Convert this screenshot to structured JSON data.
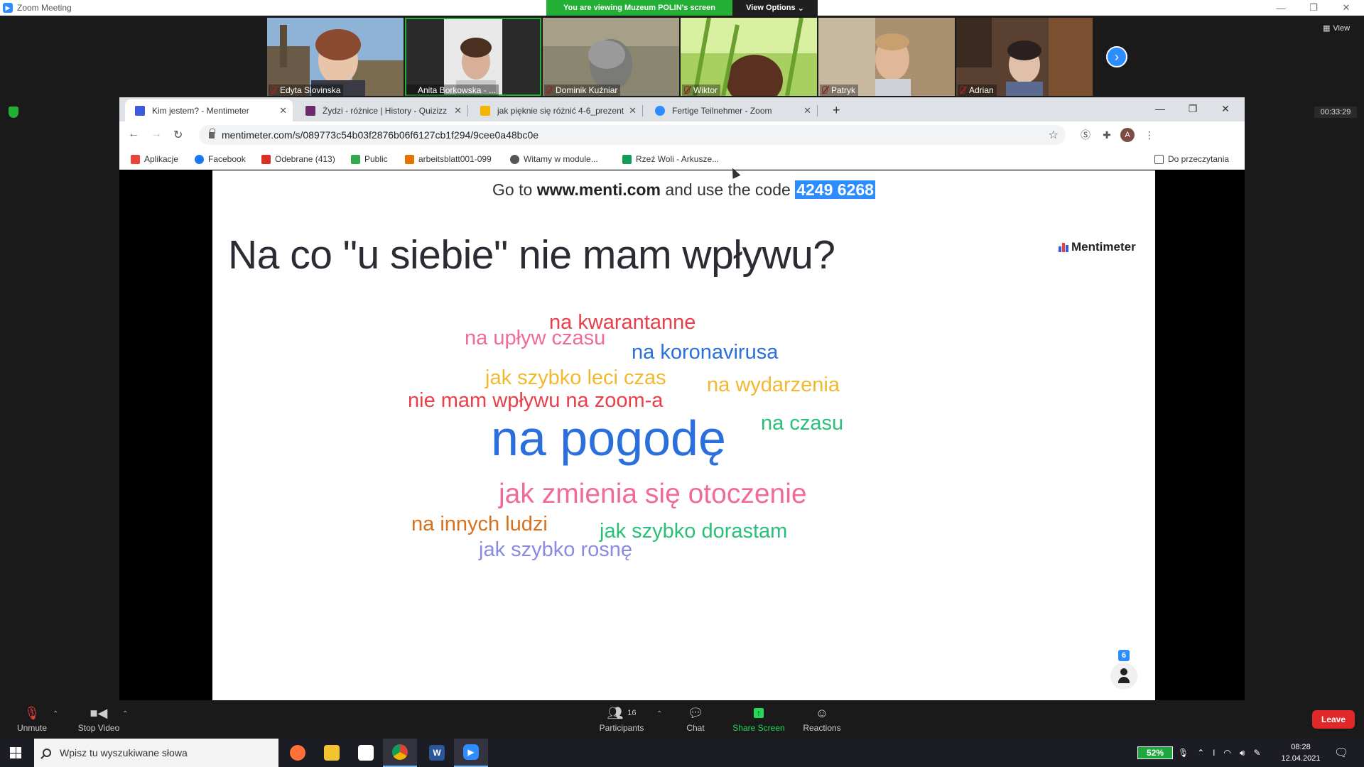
{
  "zoom": {
    "title": "Zoom Meeting",
    "share_banner": "You are viewing Muzeum POLIN's screen",
    "view_options": "View Options",
    "view_label": "View",
    "timer": "00:33:29",
    "participants": [
      {
        "name": "Edyta Slovinska",
        "bg": "#8aa8c4"
      },
      {
        "name": "Anita Borkowska - ...",
        "bg": "#3a3a3a"
      },
      {
        "name": "Dominik Kuźniar",
        "bg": "#7a7668"
      },
      {
        "name": "Wiktor",
        "bg": "#5a8a2a"
      },
      {
        "name": "Patryk",
        "bg": "#8a7060"
      },
      {
        "name": "Adrian",
        "bg": "#4a3a30"
      }
    ],
    "controls": {
      "unmute": "Unmute",
      "stop_video": "Stop Video",
      "participants": "Participants",
      "participants_count": "16",
      "chat": "Chat",
      "share_screen": "Share Screen",
      "reactions": "Reactions",
      "leave": "Leave"
    }
  },
  "browser": {
    "tabs": [
      {
        "label": "Kim jestem? - Mentimeter",
        "color": "#3b5bdb"
      },
      {
        "label": "Żydzi - różnice | History - Quizizz",
        "color": "#6c2a6a"
      },
      {
        "label": "jak pięknie się różnić 4-6_prezent",
        "color": "#f4b400"
      },
      {
        "label": "Fertige Teilnehmer - Zoom",
        "color": "#2d8cff"
      }
    ],
    "url": "mentimeter.com/s/089773c54b03f2876b06f6127cb1f294/9cee0a48bc0e",
    "avatar_letter": "A",
    "bookmarks": [
      {
        "label": "Aplikacje",
        "color": "#e8453c"
      },
      {
        "label": "Facebook",
        "color": "#1877f2"
      },
      {
        "label": "Odebrane (413)",
        "color": "#d93025"
      },
      {
        "label": "Public",
        "color": "#34a853"
      },
      {
        "label": "arbeitsblatt001-099",
        "color": "#e37400"
      },
      {
        "label": "Witamy w module...",
        "color": "#555555"
      },
      {
        "label": "Rzeź Woli - Arkusze...",
        "color": "#0f9d58"
      }
    ],
    "reading_list": "Do przeczytania"
  },
  "slide": {
    "join_prefix": "Go to ",
    "join_site": "www.menti.com",
    "join_middle": " and use the code ",
    "join_code": "4249 6268",
    "question": "Na co \"u siebie\" nie mam wpływu?",
    "brand": "Mentimeter",
    "responses_count": "6",
    "words": [
      {
        "text": "na kwarantanne",
        "color": "#e8404a"
      },
      {
        "text": "na upływ czasu",
        "color": "#f06a9a"
      },
      {
        "text": "na koronavirusa",
        "color": "#2a6fdb"
      },
      {
        "text": "jak szybko leci czas",
        "color": "#f2b830"
      },
      {
        "text": "na wydarzenia",
        "color": "#f2b830"
      },
      {
        "text": "nie mam wpływu na zoom-a",
        "color": "#e8404a"
      },
      {
        "text": "na czasu",
        "color": "#2ac07a"
      },
      {
        "text": "na pogodę",
        "color": "#2a6fdb"
      },
      {
        "text": "jak zmienia się otoczenie",
        "color": "#f06a9a"
      },
      {
        "text": "na innych ludzi",
        "color": "#d9701a"
      },
      {
        "text": "jak szybko dorastam",
        "color": "#2ac07a"
      },
      {
        "text": "jak szybko rosnę",
        "color": "#8a8ae0"
      }
    ]
  },
  "taskbar": {
    "search_placeholder": "Wpisz tu wyszukiwane słowa",
    "battery": "52%",
    "time": "08:28",
    "date": "12.04.2021"
  }
}
